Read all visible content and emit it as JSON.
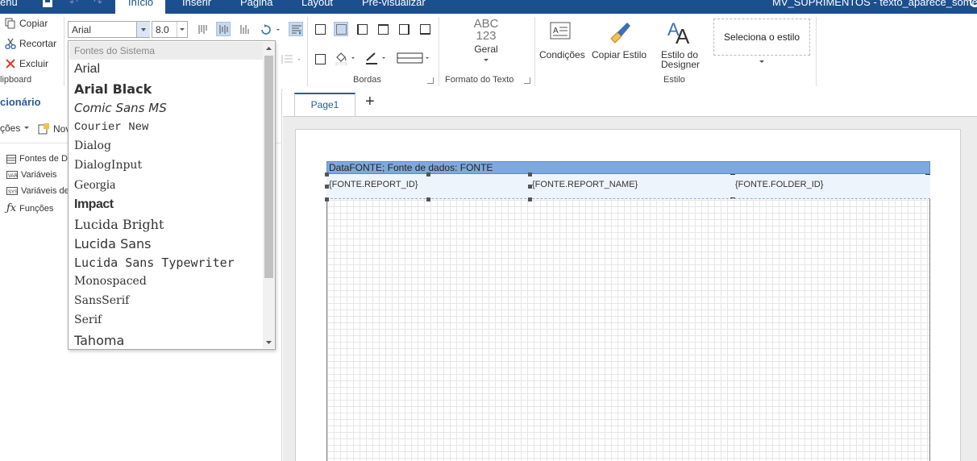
{
  "topbar": {
    "menu": "enu",
    "tabs": [
      "Início",
      "Inserir",
      "Página",
      "Layout",
      "Pré-visualizar"
    ],
    "title": "MV_SUPRIMENTOS - texto_aparece_some"
  },
  "clipboard": {
    "copy": "Copiar",
    "cut": "Recortar",
    "delete": "Excluir",
    "group": "lipboard"
  },
  "font": {
    "name": "Arial",
    "size": "8.0"
  },
  "borders": {
    "group": "Bordas"
  },
  "textformat": {
    "sample_top": "ABC",
    "sample_bottom": "123",
    "label": "Geral",
    "group": "Formato do Texto"
  },
  "style": {
    "conditions": "Condições",
    "copy_style": "Copiar Estilo",
    "designer_style_1": "Estilo do",
    "designer_style_2": "Designer",
    "select_style": "Seleciona o estilo",
    "group": "Estilo"
  },
  "leftpanel": {
    "title": "cionário",
    "actions": "ções",
    "new": "Nov",
    "tree": [
      "Fontes de D",
      "Variáveis",
      "Variáveis de",
      "Funções"
    ]
  },
  "pagetabs": {
    "page1": "Page1",
    "add": "+"
  },
  "report": {
    "band_header": "DataFONTE; Fonte de dados: FONTE",
    "fields": [
      "{FONTE.REPORT_ID}",
      "{FONTE.REPORT_NAME}",
      "{FONTE.FOLDER_ID}"
    ]
  },
  "fontdrop": {
    "header": "Fontes do Sistema",
    "options": [
      "Arial",
      "Arial Black",
      "Comic Sans MS",
      "Courier New",
      "Dialog",
      "DialogInput",
      "Georgia",
      "Impact",
      "Lucida Bright",
      "Lucida Sans",
      "Lucida Sans Typewriter",
      "Monospaced",
      "SansSerif",
      "Serif",
      "Tahoma"
    ]
  }
}
